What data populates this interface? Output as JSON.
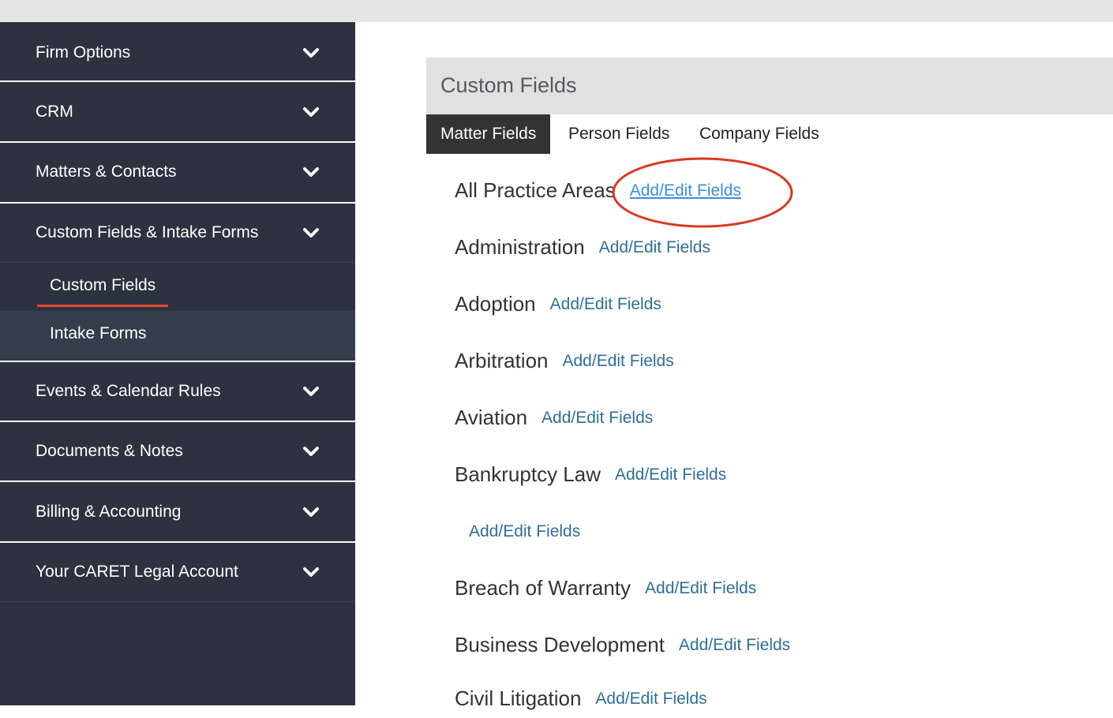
{
  "sidebar": {
    "items": [
      {
        "label": "Firm Options",
        "icon": "chevron-down-icon"
      },
      {
        "label": "CRM",
        "icon": "chevron-down-icon"
      },
      {
        "label": "Matters & Contacts",
        "icon": "chevron-down-icon"
      },
      {
        "label": "Custom Fields & Intake Forms",
        "icon": "chevron-down-icon"
      },
      {
        "label": "Events & Calendar Rules",
        "icon": "chevron-down-icon"
      },
      {
        "label": "Documents & Notes",
        "icon": "chevron-down-icon"
      },
      {
        "label": "Billing & Accounting",
        "icon": "chevron-down-icon"
      },
      {
        "label": "Your CARET Legal Account",
        "icon": "chevron-down-icon"
      }
    ],
    "subitems": [
      {
        "label": "Custom Fields",
        "active": true
      },
      {
        "label": "Intake Forms",
        "active": false
      }
    ]
  },
  "panel": {
    "title": "Custom Fields",
    "tabs": [
      {
        "label": "Matter Fields",
        "active": true
      },
      {
        "label": "Person Fields",
        "active": false
      },
      {
        "label": "Company Fields",
        "active": false
      }
    ],
    "rows": [
      {
        "name": "All Practice Areas",
        "link": "Add/Edit Fields"
      },
      {
        "name": "Administration",
        "link": "Add/Edit Fields"
      },
      {
        "name": "Adoption",
        "link": "Add/Edit Fields"
      },
      {
        "name": "Arbitration",
        "link": "Add/Edit Fields"
      },
      {
        "name": "Aviation",
        "link": "Add/Edit Fields"
      },
      {
        "name": "Bankruptcy Law",
        "link": "Add/Edit Fields"
      },
      {
        "name": "",
        "link": "Add/Edit Fields"
      },
      {
        "name": "Breach of Warranty",
        "link": "Add/Edit Fields"
      },
      {
        "name": "Business Development",
        "link": "Add/Edit Fields"
      },
      {
        "name": "Civil Litigation",
        "link": "Add/Edit Fields"
      }
    ]
  },
  "colors": {
    "sidebar_bg": "#2d3240",
    "accent_red": "#e24a2b",
    "link_blue": "#2e6e9a"
  }
}
